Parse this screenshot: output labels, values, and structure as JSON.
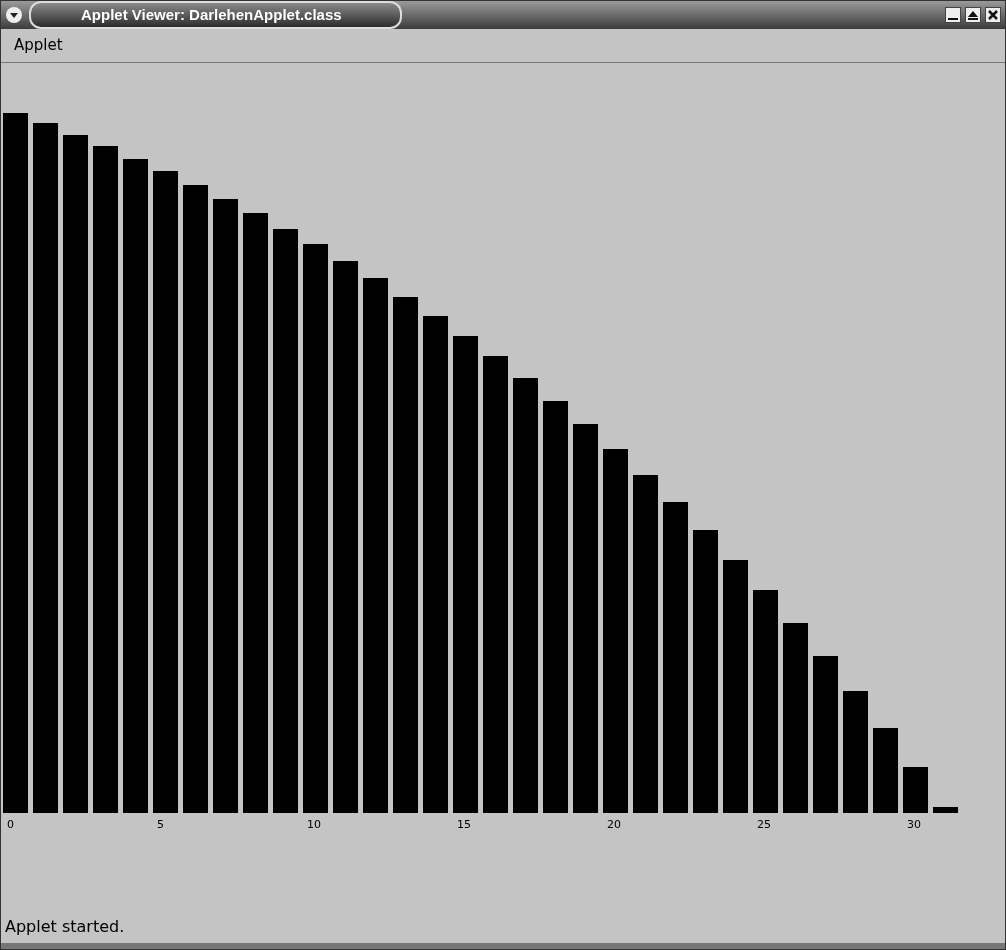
{
  "window": {
    "title": "Applet Viewer: DarlehenApplet.class"
  },
  "menu": [
    "Applet"
  ],
  "chart": {
    "x_labels": [
      "0",
      "5",
      "10",
      "15",
      "20",
      "25",
      "30"
    ]
  },
  "status_bar": "Applet started."
}
